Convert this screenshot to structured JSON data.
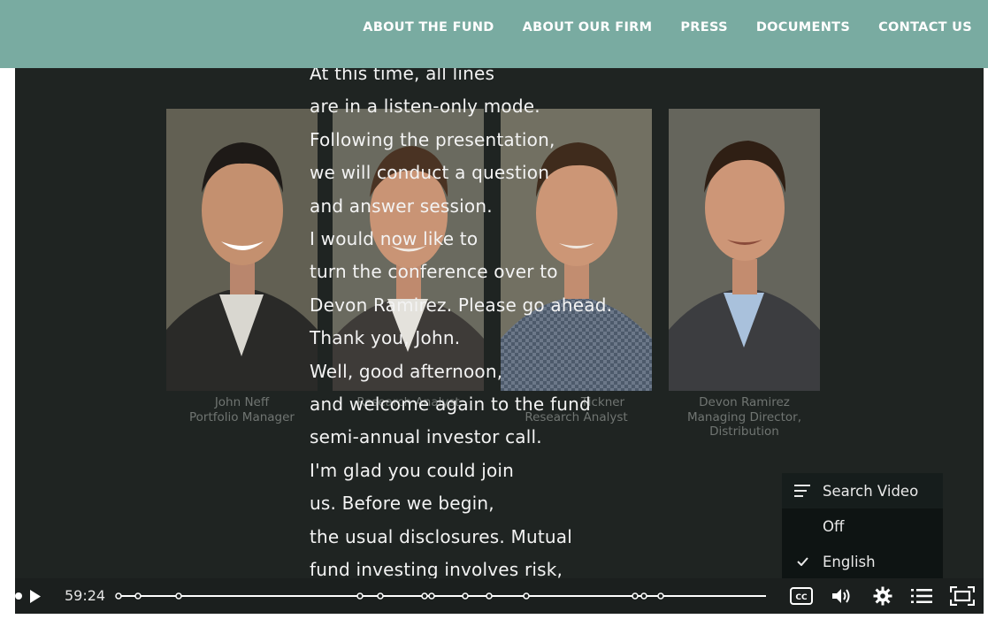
{
  "nav": {
    "items": [
      "ABOUT THE FUND",
      "ABOUT OUR FIRM",
      "PRESS",
      "DOCUMENTS",
      "CONTACT US"
    ]
  },
  "people": [
    {
      "name": "John Neff",
      "title": "Portfolio Manager"
    },
    {
      "name": "",
      "title": "Research Analyst"
    },
    {
      "name": "Tickner",
      "title": "Research Analyst"
    },
    {
      "name": "Devon Ramirez",
      "title": "Managing Director,",
      "title2": "Distribution"
    }
  ],
  "transcript": {
    "lines": [
      "At this time, all lines",
      "are in a listen-only mode.",
      "Following the presentation,",
      "we will conduct a question",
      "and answer session.",
      "I would now like to",
      "turn the conference over to",
      "Devon Ramirez. Please go ahead.",
      "Thank you, John.",
      "Well, good afternoon,",
      "and welcome again to the fund",
      "semi-annual investor call.",
      "I'm glad you could join",
      "us. Before we begin,",
      "the usual disclosures. Mutual",
      "fund investing involves risk,"
    ]
  },
  "cc_menu": {
    "search_label": "Search Video",
    "off_label": "Off",
    "english_label": "English",
    "selected": "English"
  },
  "player": {
    "time": "59:24",
    "progress": 0.98
  },
  "colors": {
    "header": "#79aba1",
    "video_bg": "#1f2422",
    "controls_bg": "#1b1f1e"
  }
}
